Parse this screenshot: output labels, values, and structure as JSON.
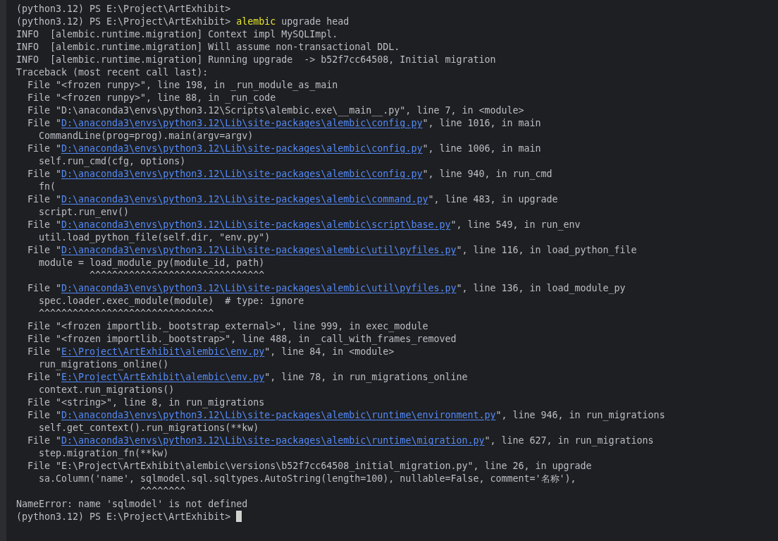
{
  "terminal": {
    "lines": [
      {
        "segments": [
          {
            "kind": "plain",
            "text": "(python3.12) PS E:\\Project\\ArtExhibit>"
          }
        ]
      },
      {
        "segments": [
          {
            "kind": "plain",
            "text": "(python3.12) PS E:\\Project\\ArtExhibit> "
          },
          {
            "kind": "command",
            "text": "alembic"
          },
          {
            "kind": "plain",
            "text": " upgrade head"
          }
        ]
      },
      {
        "segments": [
          {
            "kind": "plain",
            "text": "INFO  [alembic.runtime.migration] Context impl MySQLImpl."
          }
        ]
      },
      {
        "segments": [
          {
            "kind": "plain",
            "text": "INFO  [alembic.runtime.migration] Will assume non-transactional DDL."
          }
        ]
      },
      {
        "segments": [
          {
            "kind": "plain",
            "text": "INFO  [alembic.runtime.migration] Running upgrade  -> b52f7cc64508, Initial migration"
          }
        ]
      },
      {
        "segments": [
          {
            "kind": "plain",
            "text": "Traceback (most recent call last):"
          }
        ]
      },
      {
        "segments": [
          {
            "kind": "plain",
            "text": "  File \"<frozen runpy>\", line 198, in _run_module_as_main"
          }
        ]
      },
      {
        "segments": [
          {
            "kind": "plain",
            "text": "  File \"<frozen runpy>\", line 88, in _run_code"
          }
        ]
      },
      {
        "segments": [
          {
            "kind": "plain",
            "text": "  File \"D:\\anaconda3\\envs\\python3.12\\Scripts\\alembic.exe\\__main__.py\", line 7, in <module>"
          }
        ]
      },
      {
        "segments": [
          {
            "kind": "plain",
            "text": "  File \""
          },
          {
            "kind": "link",
            "text": "D:\\anaconda3\\envs\\python3.12\\Lib\\site-packages\\alembic\\config.py"
          },
          {
            "kind": "plain",
            "text": "\", line 1016, in main"
          }
        ]
      },
      {
        "segments": [
          {
            "kind": "plain",
            "text": "    CommandLine(prog=prog).main(argv=argv)"
          }
        ]
      },
      {
        "segments": [
          {
            "kind": "plain",
            "text": "  File \""
          },
          {
            "kind": "link",
            "text": "D:\\anaconda3\\envs\\python3.12\\Lib\\site-packages\\alembic\\config.py"
          },
          {
            "kind": "plain",
            "text": "\", line 1006, in main"
          }
        ]
      },
      {
        "segments": [
          {
            "kind": "plain",
            "text": "    self.run_cmd(cfg, options)"
          }
        ]
      },
      {
        "segments": [
          {
            "kind": "plain",
            "text": "  File \""
          },
          {
            "kind": "link",
            "text": "D:\\anaconda3\\envs\\python3.12\\Lib\\site-packages\\alembic\\config.py"
          },
          {
            "kind": "plain",
            "text": "\", line 940, in run_cmd"
          }
        ]
      },
      {
        "segments": [
          {
            "kind": "plain",
            "text": "    fn("
          }
        ]
      },
      {
        "segments": [
          {
            "kind": "plain",
            "text": "  File \""
          },
          {
            "kind": "link",
            "text": "D:\\anaconda3\\envs\\python3.12\\Lib\\site-packages\\alembic\\command.py"
          },
          {
            "kind": "plain",
            "text": "\", line 483, in upgrade"
          }
        ]
      },
      {
        "segments": [
          {
            "kind": "plain",
            "text": "    script.run_env()"
          }
        ]
      },
      {
        "segments": [
          {
            "kind": "plain",
            "text": "  File \""
          },
          {
            "kind": "link",
            "text": "D:\\anaconda3\\envs\\python3.12\\Lib\\site-packages\\alembic\\script\\base.py"
          },
          {
            "kind": "plain",
            "text": "\", line 549, in run_env"
          }
        ]
      },
      {
        "segments": [
          {
            "kind": "plain",
            "text": "    util.load_python_file(self.dir, \"env.py\")"
          }
        ]
      },
      {
        "segments": [
          {
            "kind": "plain",
            "text": "  File \""
          },
          {
            "kind": "link",
            "text": "D:\\anaconda3\\envs\\python3.12\\Lib\\site-packages\\alembic\\util\\pyfiles.py"
          },
          {
            "kind": "plain",
            "text": "\", line 116, in load_python_file"
          }
        ]
      },
      {
        "segments": [
          {
            "kind": "plain",
            "text": "    module = load_module_py(module_id, path)"
          }
        ]
      },
      {
        "segments": [
          {
            "kind": "plain",
            "text": "             ^^^^^^^^^^^^^^^^^^^^^^^^^^^^^^^"
          }
        ]
      },
      {
        "segments": [
          {
            "kind": "plain",
            "text": "  File \""
          },
          {
            "kind": "link",
            "text": "D:\\anaconda3\\envs\\python3.12\\Lib\\site-packages\\alembic\\util\\pyfiles.py"
          },
          {
            "kind": "plain",
            "text": "\", line 136, in load_module_py"
          }
        ]
      },
      {
        "segments": [
          {
            "kind": "plain",
            "text": "    spec.loader.exec_module(module)  # type: ignore"
          }
        ]
      },
      {
        "segments": [
          {
            "kind": "plain",
            "text": "    ^^^^^^^^^^^^^^^^^^^^^^^^^^^^^^^"
          }
        ]
      },
      {
        "segments": [
          {
            "kind": "plain",
            "text": "  File \"<frozen importlib._bootstrap_external>\", line 999, in exec_module"
          }
        ]
      },
      {
        "segments": [
          {
            "kind": "plain",
            "text": "  File \"<frozen importlib._bootstrap>\", line 488, in _call_with_frames_removed"
          }
        ]
      },
      {
        "segments": [
          {
            "kind": "plain",
            "text": "  File \""
          },
          {
            "kind": "link",
            "text": "E:\\Project\\ArtExhibit\\alembic\\env.py"
          },
          {
            "kind": "plain",
            "text": "\", line 84, in <module>"
          }
        ]
      },
      {
        "segments": [
          {
            "kind": "plain",
            "text": "    run_migrations_online()"
          }
        ]
      },
      {
        "segments": [
          {
            "kind": "plain",
            "text": "  File \""
          },
          {
            "kind": "link",
            "text": "E:\\Project\\ArtExhibit\\alembic\\env.py"
          },
          {
            "kind": "plain",
            "text": "\", line 78, in run_migrations_online"
          }
        ]
      },
      {
        "segments": [
          {
            "kind": "plain",
            "text": "    context.run_migrations()"
          }
        ]
      },
      {
        "segments": [
          {
            "kind": "plain",
            "text": "  File \"<string>\", line 8, in run_migrations"
          }
        ]
      },
      {
        "segments": [
          {
            "kind": "plain",
            "text": "  File \""
          },
          {
            "kind": "link",
            "text": "D:\\anaconda3\\envs\\python3.12\\Lib\\site-packages\\alembic\\runtime\\environment.py"
          },
          {
            "kind": "plain",
            "text": "\", line 946, in run_migrations"
          }
        ]
      },
      {
        "segments": [
          {
            "kind": "plain",
            "text": "    self.get_context().run_migrations(**kw)"
          }
        ]
      },
      {
        "segments": [
          {
            "kind": "plain",
            "text": "  File \""
          },
          {
            "kind": "link",
            "text": "D:\\anaconda3\\envs\\python3.12\\Lib\\site-packages\\alembic\\runtime\\migration.py"
          },
          {
            "kind": "plain",
            "text": "\", line 627, in run_migrations"
          }
        ]
      },
      {
        "segments": [
          {
            "kind": "plain",
            "text": "    step.migration_fn(**kw)"
          }
        ]
      },
      {
        "segments": [
          {
            "kind": "plain",
            "text": "  File \"E:\\Project\\ArtExhibit\\alembic\\versions\\b52f7cc64508_initial_migration.py\", line 26, in upgrade"
          }
        ]
      },
      {
        "segments": [
          {
            "kind": "plain",
            "text": "    sa.Column('name', sqlmodel.sql.sqltypes.AutoString(length=100), nullable=False, comment='名称'),"
          }
        ]
      },
      {
        "segments": [
          {
            "kind": "plain",
            "text": "                      ^^^^^^^^"
          }
        ]
      },
      {
        "segments": [
          {
            "kind": "plain",
            "text": "NameError: name 'sqlmodel' is not defined"
          }
        ]
      },
      {
        "segments": [
          {
            "kind": "plain",
            "text": "(python3.12) PS E:\\Project\\ArtExhibit> "
          }
        ],
        "cursor": true
      }
    ]
  }
}
